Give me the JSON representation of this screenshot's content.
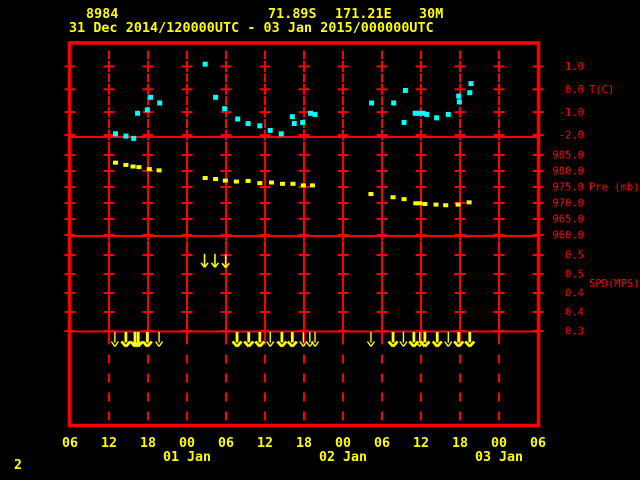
{
  "header": {
    "station_id": "8984",
    "latitude": "71.89S",
    "longitude": "171.21E",
    "elevation": "30M",
    "time_range": "31 Dec 2014/120000UTC - 03 Jan 2015/000000UTC"
  },
  "page_number": "2",
  "colors": {
    "background": "#000000",
    "grid": "#ff0000",
    "header_text": "#ffff00",
    "temperature": "#00ffff",
    "pressure": "#ffff00",
    "wind": "#ffff00"
  },
  "axes": {
    "temperature": {
      "unit_label": "T(C)",
      "tick_labels": [
        "1.0",
        "0.0",
        "-1.0",
        "-2.0"
      ],
      "tick_values": [
        1.0,
        0.0,
        -1.0,
        -2.0
      ]
    },
    "pressure": {
      "unit_label": "Pre (mb)",
      "tick_labels": [
        "985.0",
        "980.0",
        "975.0",
        "970.0",
        "965.0",
        "960.0"
      ],
      "tick_values": [
        985,
        980,
        975,
        970,
        965,
        960
      ]
    },
    "speed": {
      "unit_label": "SPD(MPS)",
      "tick_labels": [
        "0.5",
        "0.5",
        "0.4",
        "0.4",
        "0.3"
      ],
      "tick_values": [
        0.5,
        0.45,
        0.4,
        0.35,
        0.3
      ]
    },
    "time": {
      "hour_labels": [
        "06",
        "12",
        "18",
        "00",
        "06",
        "12",
        "18",
        "00",
        "06",
        "12",
        "18",
        "00",
        "06"
      ],
      "date_labels": [
        "01 Jan",
        "02 Jan",
        "03 Jan"
      ]
    }
  },
  "chart_data": {
    "type": "scatter",
    "title": "",
    "time_origin": "2014-12-31 06:00 UTC",
    "hours_span": 72,
    "x_unit": "hours since 31 Dec 2014 06UTC",
    "series": [
      {
        "name": "temperature_c",
        "color": "#00ffff",
        "points": [
          [
            7.0,
            -1.95
          ],
          [
            8.6,
            -2.05
          ],
          [
            9.8,
            -2.15
          ],
          [
            10.4,
            -1.05
          ],
          [
            11.9,
            -0.9
          ],
          [
            12.4,
            -0.35
          ],
          [
            13.8,
            -0.6
          ],
          [
            20.8,
            1.1
          ],
          [
            22.4,
            -0.35
          ],
          [
            23.8,
            -0.85
          ],
          [
            25.8,
            -1.3
          ],
          [
            27.4,
            -1.5
          ],
          [
            29.2,
            -1.6
          ],
          [
            30.8,
            -1.8
          ],
          [
            32.5,
            -1.95
          ],
          [
            34.2,
            -1.2
          ],
          [
            34.5,
            -1.5
          ],
          [
            35.8,
            -1.45
          ],
          [
            37.0,
            -1.05
          ],
          [
            37.7,
            -1.1
          ],
          [
            46.4,
            -0.6
          ],
          [
            49.8,
            -0.6
          ],
          [
            51.4,
            -1.45
          ],
          [
            51.6,
            -0.05
          ],
          [
            53.1,
            -1.05
          ],
          [
            53.6,
            -1.05
          ],
          [
            54.3,
            -1.05
          ],
          [
            54.9,
            -1.1
          ],
          [
            56.4,
            -1.25
          ],
          [
            58.2,
            -1.1
          ],
          [
            59.8,
            -0.3
          ],
          [
            59.9,
            -0.55
          ],
          [
            61.5,
            -0.15
          ],
          [
            61.7,
            0.25
          ]
        ]
      },
      {
        "name": "pressure_mb",
        "color": "#ffff00",
        "points": [
          [
            7.0,
            982.6
          ],
          [
            8.6,
            981.9
          ],
          [
            9.7,
            981.4
          ],
          [
            10.6,
            981.2
          ],
          [
            12.2,
            980.6
          ],
          [
            13.7,
            980.2
          ],
          [
            20.8,
            977.8
          ],
          [
            22.4,
            977.5
          ],
          [
            23.9,
            977.0
          ],
          [
            25.6,
            976.7
          ],
          [
            27.4,
            976.9
          ],
          [
            29.2,
            976.2
          ],
          [
            31.0,
            976.4
          ],
          [
            32.7,
            976.0
          ],
          [
            34.3,
            976.0
          ],
          [
            35.9,
            975.5
          ],
          [
            37.3,
            975.5
          ],
          [
            46.3,
            972.8
          ],
          [
            49.7,
            971.8
          ],
          [
            51.4,
            971.2
          ],
          [
            53.2,
            969.9
          ],
          [
            53.8,
            969.9
          ],
          [
            54.6,
            969.7
          ],
          [
            56.3,
            969.5
          ],
          [
            57.8,
            969.3
          ],
          [
            59.7,
            969.5
          ],
          [
            61.4,
            970.2
          ]
        ]
      }
    ],
    "wind_speed_arrows": {
      "color": "#ffff00",
      "points": [
        [
          20.7,
          0.486
        ],
        [
          22.3,
          0.486
        ],
        [
          23.95,
          0.485
        ]
      ]
    },
    "wind_direction_arrows": {
      "color": "#ffff00",
      "direction": "down",
      "events": [
        {
          "t": 6.9,
          "bold": false
        },
        {
          "t": 8.6,
          "bold": true
        },
        {
          "t": 10.0,
          "bold": true
        },
        {
          "t": 10.5,
          "bold": true
        },
        {
          "t": 11.9,
          "bold": true
        },
        {
          "t": 13.7,
          "bold": false
        },
        {
          "t": 25.7,
          "bold": true
        },
        {
          "t": 27.5,
          "bold": true
        },
        {
          "t": 29.2,
          "bold": true
        },
        {
          "t": 30.8,
          "bold": false
        },
        {
          "t": 32.6,
          "bold": true
        },
        {
          "t": 34.2,
          "bold": true
        },
        {
          "t": 35.9,
          "bold": false
        },
        {
          "t": 36.9,
          "bold": false
        },
        {
          "t": 37.7,
          "bold": false
        },
        {
          "t": 46.3,
          "bold": false
        },
        {
          "t": 49.7,
          "bold": true
        },
        {
          "t": 51.3,
          "bold": false
        },
        {
          "t": 52.9,
          "bold": true
        },
        {
          "t": 53.8,
          "bold": false
        },
        {
          "t": 54.6,
          "bold": true
        },
        {
          "t": 56.5,
          "bold": true
        },
        {
          "t": 58.2,
          "bold": false
        },
        {
          "t": 59.8,
          "bold": true
        },
        {
          "t": 61.5,
          "bold": true
        }
      ]
    }
  }
}
